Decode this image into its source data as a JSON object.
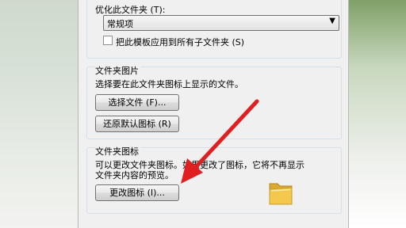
{
  "optimize": {
    "label": "优化此文件夹 (T):",
    "select_value": "常规项",
    "checkbox_label": "把此模板应用到所有子文件夹 (S)"
  },
  "folder_picture": {
    "title": "文件夹图片",
    "description": "选择要在此文件夹图标上显示的文件。",
    "choose_file_button": "选择文件 (F)...",
    "restore_default_button": "还原默认图标 (R)"
  },
  "folder_icon": {
    "title": "文件夹图标",
    "description_line1": "可以更改文件夹图标。如果更改了图标，它将不再显示",
    "description_line2": "文件夹内容的预览。",
    "change_icon_button": "更改图标 (I)..."
  },
  "icons": {
    "dropdown": "chevron-down-icon",
    "folder": "folder-icon",
    "annotation": "red-arrow-annotation"
  },
  "colors": {
    "arrow": "#e02020",
    "folder": "#f2c94c"
  }
}
